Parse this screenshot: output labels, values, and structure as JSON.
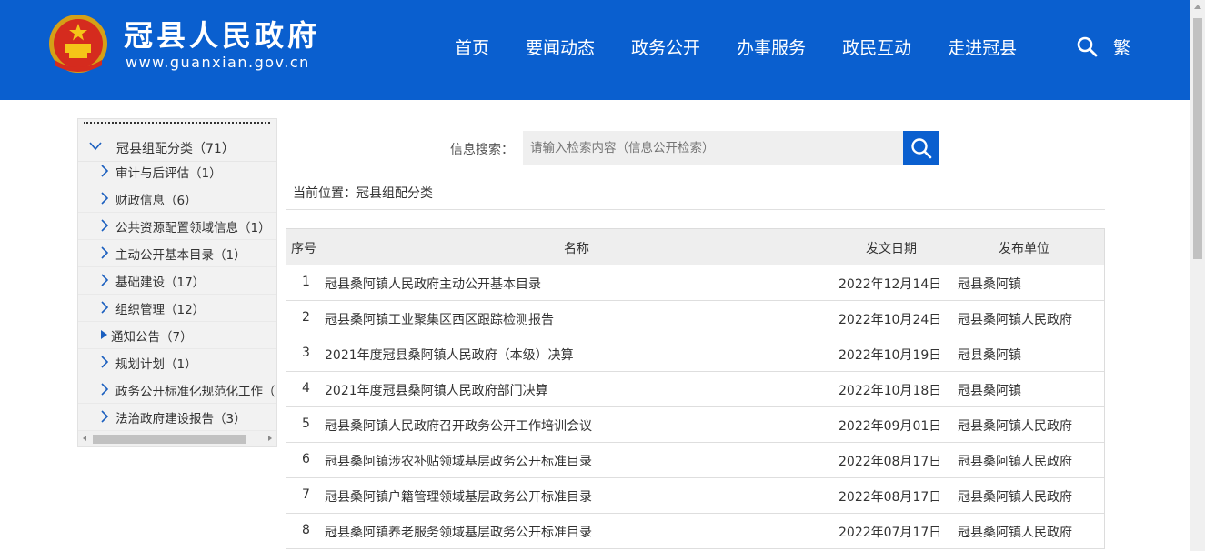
{
  "header": {
    "site_title": "冠县人民政府",
    "site_url": "www.guanxian.gov.cn",
    "nav": [
      "首页",
      "要闻动态",
      "政务公开",
      "办事服务",
      "政民互动",
      "走进冠县"
    ],
    "traditional_label": "繁",
    "brand_color": "#0a5fcf"
  },
  "sidebar": {
    "root_label": "冠县组配分类（71）",
    "items": [
      {
        "label": "审计与后评估（1）",
        "selected": false
      },
      {
        "label": "财政信息（6）",
        "selected": false
      },
      {
        "label": "公共资源配置领域信息（1）",
        "selected": false
      },
      {
        "label": "主动公开基本目录（1）",
        "selected": false
      },
      {
        "label": "基础建设（17）",
        "selected": false
      },
      {
        "label": "组织管理（12）",
        "selected": false
      },
      {
        "label": "通知公告（7）",
        "selected": true
      },
      {
        "label": "规划计划（1）",
        "selected": false
      },
      {
        "label": "政务公开标准化规范化工作（",
        "selected": false
      },
      {
        "label": "法治政府建设报告（3）",
        "selected": false
      }
    ]
  },
  "search": {
    "label": "信息搜索：",
    "placeholder": "请输入检索内容（信息公开检索）"
  },
  "breadcrumb": "当前位置：冠县组配分类",
  "table": {
    "headers": {
      "no": "序号",
      "name": "名称",
      "date": "发文日期",
      "unit": "发布单位"
    },
    "rows": [
      {
        "no": "1",
        "name": "冠县桑阿镇人民政府主动公开基本目录",
        "date": "2022年12月14日",
        "unit": "冠县桑阿镇"
      },
      {
        "no": "2",
        "name": "冠县桑阿镇工业聚集区西区跟踪检测报告",
        "date": "2022年10月24日",
        "unit": "冠县桑阿镇人民政府"
      },
      {
        "no": "3",
        "name": "2021年度冠县桑阿镇人民政府（本级）决算",
        "date": "2022年10月19日",
        "unit": "冠县桑阿镇"
      },
      {
        "no": "4",
        "name": "2021年度冠县桑阿镇人民政府部门决算",
        "date": "2022年10月18日",
        "unit": "冠县桑阿镇"
      },
      {
        "no": "5",
        "name": "冠县桑阿镇人民政府召开政务公开工作培训会议",
        "date": "2022年09月01日",
        "unit": "冠县桑阿镇人民政府"
      },
      {
        "no": "6",
        "name": "冠县桑阿镇涉农补贴领域基层政务公开标准目录",
        "date": "2022年08月17日",
        "unit": "冠县桑阿镇人民政府"
      },
      {
        "no": "7",
        "name": "冠县桑阿镇户籍管理领域基层政务公开标准目录",
        "date": "2022年08月17日",
        "unit": "冠县桑阿镇人民政府"
      },
      {
        "no": "8",
        "name": "冠县桑阿镇养老服务领域基层政务公开标准目录",
        "date": "2022年07月17日",
        "unit": "冠县桑阿镇人民政府"
      }
    ]
  }
}
